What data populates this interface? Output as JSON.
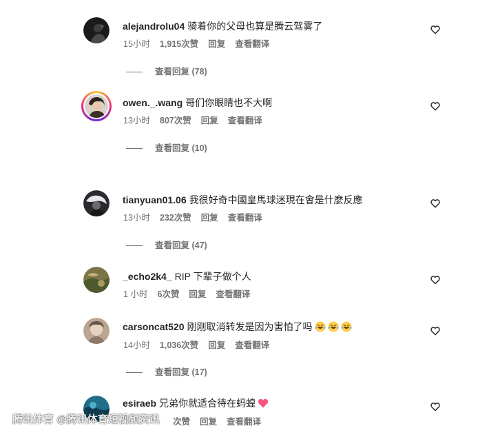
{
  "comments": [
    {
      "username": "alejandrolu04",
      "text": "骑着你的父母也算是腾云驾雾了",
      "time": "15小时",
      "likes": "1,915次赞",
      "reply": "回复",
      "translate": "查看翻译",
      "view_replies": "查看回复 (78)",
      "avatar_color": "#1b1b1b"
    },
    {
      "username": "owen._.wang",
      "text": "哥们你眼睛也不大啊",
      "time": "13小时",
      "likes": "807次赞",
      "reply": "回复",
      "translate": "查看翻译",
      "view_replies": "查看回复 (10)",
      "avatar_color": "#3a2f2a"
    },
    {
      "username": "tianyuan01.06",
      "text": "我很好奇中國皇馬球迷現在會是什麼反應",
      "time": "13小时",
      "likes": "232次赞",
      "reply": "回复",
      "translate": "查看翻译",
      "view_replies": "查看回复 (47)",
      "avatar_color": "#2a2a2e"
    },
    {
      "username": "_echo2k4_",
      "text": "RIP 下辈子做个人",
      "time": "1 小时",
      "likes": "6次赞",
      "reply": "回复",
      "translate": "查看翻译",
      "avatar_color": "#7a7448"
    },
    {
      "username": "carsoncat520",
      "text": "刚刚取消转发是因为害怕了吗",
      "time": "14小时",
      "likes": "1,036次赞",
      "reply": "回复",
      "translate": "查看翻译",
      "view_replies": "查看回复 (17)",
      "avatar_color": "#b9a591",
      "emoji_icons": [
        "laughing-crying-emoji",
        "laughing-crying-emoji",
        "laughing-crying-emoji"
      ]
    },
    {
      "username": "esiraeb",
      "text": "兄弟你就适合待在蚂蝗",
      "likes": "次赞",
      "reply": "回复",
      "translate": "查看翻译",
      "avatar_color": "#1f6f8b",
      "emoji_icons": [
        "pink-heart-emoji"
      ]
    }
  ],
  "watermark": "腾讯体育 @腾讯体育短视频资讯",
  "colors": {
    "secondary_text": "#737373",
    "primary_text": "#262626"
  }
}
